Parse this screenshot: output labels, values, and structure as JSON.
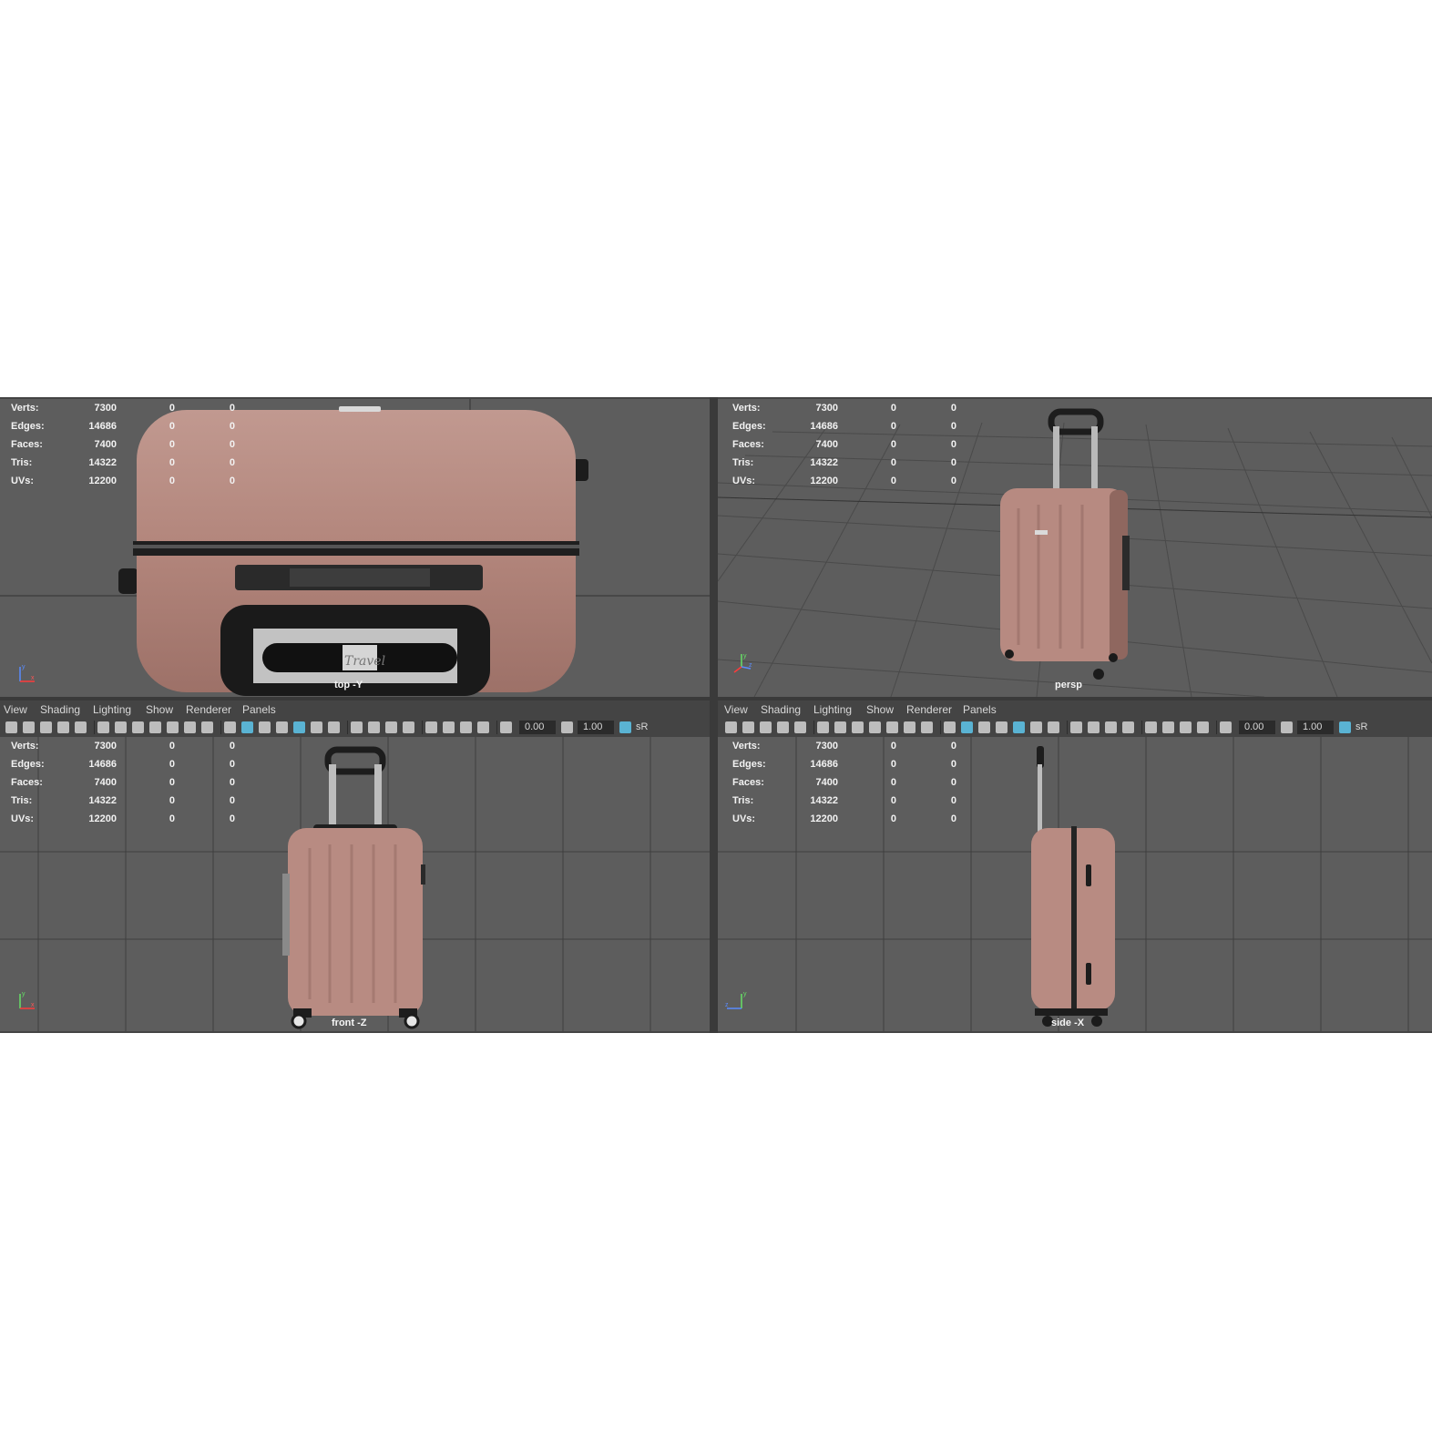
{
  "menu": [
    "View",
    "Shading",
    "Lighting",
    "Show",
    "Renderer",
    "Panels"
  ],
  "toolbar": {
    "exposure": "0.00",
    "gamma": "1.00",
    "colorspace": "sR"
  },
  "hud": {
    "rows": [
      {
        "label": "Verts:",
        "values": [
          "7300",
          "0",
          "0"
        ]
      },
      {
        "label": "Edges:",
        "values": [
          "14686",
          "0",
          "0"
        ]
      },
      {
        "label": "Faces:",
        "values": [
          "7400",
          "0",
          "0"
        ]
      },
      {
        "label": "Tris:",
        "values": [
          "14322",
          "0",
          "0"
        ]
      },
      {
        "label": "UVs:",
        "values": [
          "12200",
          "0",
          "0"
        ]
      }
    ]
  },
  "viewports": {
    "top": {
      "camera": "top -Y"
    },
    "persp": {
      "camera": "persp"
    },
    "front": {
      "camera": "front -Z"
    },
    "side": {
      "camera": "side -X"
    }
  },
  "logo_text": "Travel",
  "colors": {
    "viewport_bg": "#5d5d5d",
    "suitcase": "#b5877e",
    "accent": "#5ab3d3"
  }
}
